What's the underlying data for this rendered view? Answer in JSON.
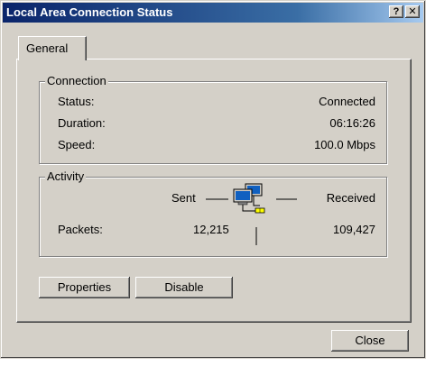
{
  "window": {
    "title": "Local Area Connection Status",
    "help_label": "?",
    "close_glyph": "✕"
  },
  "tabs": [
    {
      "label": "General"
    }
  ],
  "connection": {
    "legend": "Connection",
    "rows": [
      {
        "label": "Status:",
        "value": "Connected"
      },
      {
        "label": "Duration:",
        "value": "06:16:26"
      },
      {
        "label": "Speed:",
        "value": "100.0 Mbps"
      }
    ]
  },
  "activity": {
    "legend": "Activity",
    "sent_label": "Sent",
    "received_label": "Received",
    "packets_label": "Packets:",
    "packets_sent": "12,215",
    "packets_received": "109,427",
    "icon": "network-activity-icon"
  },
  "buttons": {
    "properties": "Properties",
    "disable": "Disable",
    "close": "Close"
  }
}
